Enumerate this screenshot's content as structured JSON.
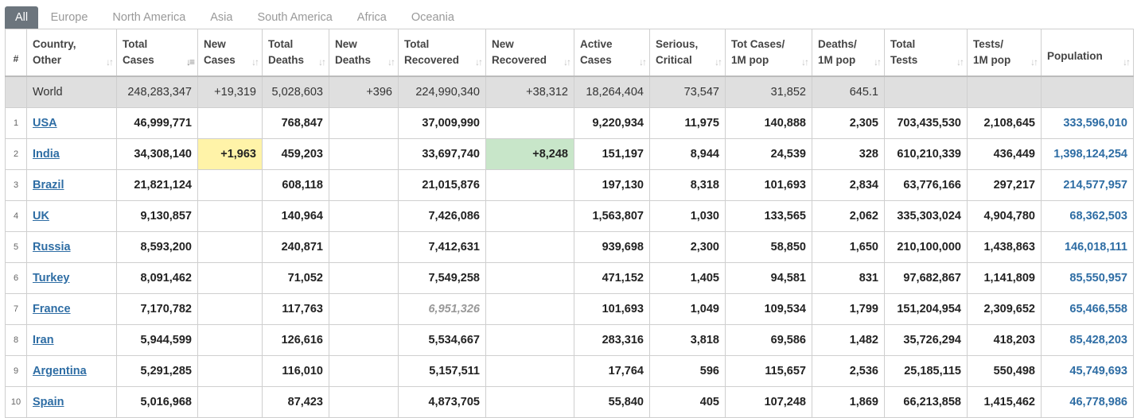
{
  "tabs": [
    "All",
    "Europe",
    "North America",
    "Asia",
    "South America",
    "Africa",
    "Oceania"
  ],
  "headers": [
    {
      "l1": "#",
      "l2": ""
    },
    {
      "l1": "Country,",
      "l2": "Other"
    },
    {
      "l1": "Total",
      "l2": "Cases"
    },
    {
      "l1": "New",
      "l2": "Cases"
    },
    {
      "l1": "Total",
      "l2": "Deaths"
    },
    {
      "l1": "New",
      "l2": "Deaths"
    },
    {
      "l1": "Total",
      "l2": "Recovered"
    },
    {
      "l1": "New",
      "l2": "Recovered"
    },
    {
      "l1": "Active",
      "l2": "Cases"
    },
    {
      "l1": "Serious,",
      "l2": "Critical"
    },
    {
      "l1": "Tot Cases/",
      "l2": "1M pop"
    },
    {
      "l1": "Deaths/",
      "l2": "1M pop"
    },
    {
      "l1": "Total",
      "l2": "Tests"
    },
    {
      "l1": "Tests/",
      "l2": "1M pop"
    },
    {
      "l1": "Population",
      "l2": ""
    }
  ],
  "world": [
    "",
    "World",
    "248,283,347",
    "+19,319",
    "5,028,603",
    "+396",
    "224,990,340",
    "+38,312",
    "18,264,404",
    "73,547",
    "31,852",
    "645.1",
    "",
    "",
    ""
  ],
  "rows": [
    [
      "1",
      "USA",
      "46,999,771",
      "",
      "768,847",
      "",
      "37,009,990",
      "",
      "9,220,934",
      "11,975",
      "140,888",
      "2,305",
      "703,435,530",
      "2,108,645",
      "333,596,010"
    ],
    [
      "2",
      "India",
      "34,308,140",
      "+1,963",
      "459,203",
      "",
      "33,697,740",
      "+8,248",
      "151,197",
      "8,944",
      "24,539",
      "328",
      "610,210,339",
      "436,449",
      "1,398,124,254"
    ],
    [
      "3",
      "Brazil",
      "21,821,124",
      "",
      "608,118",
      "",
      "21,015,876",
      "",
      "197,130",
      "8,318",
      "101,693",
      "2,834",
      "63,776,166",
      "297,217",
      "214,577,957"
    ],
    [
      "4",
      "UK",
      "9,130,857",
      "",
      "140,964",
      "",
      "7,426,086",
      "",
      "1,563,807",
      "1,030",
      "133,565",
      "2,062",
      "335,303,024",
      "4,904,780",
      "68,362,503"
    ],
    [
      "5",
      "Russia",
      "8,593,200",
      "",
      "240,871",
      "",
      "7,412,631",
      "",
      "939,698",
      "2,300",
      "58,850",
      "1,650",
      "210,100,000",
      "1,438,863",
      "146,018,111"
    ],
    [
      "6",
      "Turkey",
      "8,091,462",
      "",
      "71,052",
      "",
      "7,549,258",
      "",
      "471,152",
      "1,405",
      "94,581",
      "831",
      "97,682,867",
      "1,141,809",
      "85,550,957"
    ],
    [
      "7",
      "France",
      "7,170,782",
      "",
      "117,763",
      "",
      "6,951,326",
      "",
      "101,693",
      "1,049",
      "109,534",
      "1,799",
      "151,204,954",
      "2,309,652",
      "65,466,558"
    ],
    [
      "8",
      "Iran",
      "5,944,599",
      "",
      "126,616",
      "",
      "5,534,667",
      "",
      "283,316",
      "3,818",
      "69,586",
      "1,482",
      "35,726,294",
      "418,203",
      "85,428,203"
    ],
    [
      "9",
      "Argentina",
      "5,291,285",
      "",
      "116,010",
      "",
      "5,157,511",
      "",
      "17,764",
      "596",
      "115,657",
      "2,536",
      "25,185,115",
      "550,498",
      "45,749,693"
    ],
    [
      "10",
      "Spain",
      "5,016,968",
      "",
      "87,423",
      "",
      "4,873,705",
      "",
      "55,840",
      "405",
      "107,248",
      "1,869",
      "66,213,858",
      "1,415,462",
      "46,778,986"
    ]
  ],
  "colors": {
    "link": "#2e6da4",
    "new_cases_highlight": "#fff3a8",
    "new_recovered_highlight": "#c8e6c9",
    "world_row": "#dfdfdf",
    "active_tab": "#6c757d"
  },
  "icons": {
    "sort": "sort-arrows-icon",
    "sort_active": "sort-desc-icon"
  }
}
